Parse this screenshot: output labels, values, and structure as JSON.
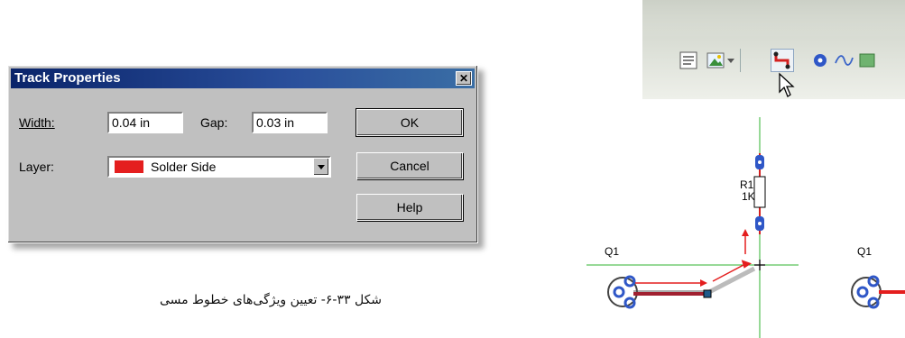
{
  "dialog": {
    "title": "Track Properties",
    "close_label": "✕",
    "width_label": "Width:",
    "width_value": "0.04 in",
    "gap_label": "Gap:",
    "gap_value": "0.03 in",
    "layer_label": "Layer:",
    "layer_value": "Solder Side",
    "layer_color": "#e41e1e",
    "ok_label": "OK",
    "cancel_label": "Cancel",
    "help_label": "Help"
  },
  "caption": "شکل ۳۳-۶- تعیین ویژگی‌های خطوط مسی",
  "toolbar": {
    "icons": [
      "text-icon",
      "image-icon",
      "track-icon",
      "via-icon",
      "curve-icon",
      "fill-icon"
    ],
    "active_color": "#d42020"
  },
  "schematic": {
    "resistor_name": "R1",
    "resistor_value": "1K",
    "component_left": "Q1",
    "component_right": "Q1",
    "track_color": "#e41e1e",
    "guide_color": "#2fb32f"
  }
}
